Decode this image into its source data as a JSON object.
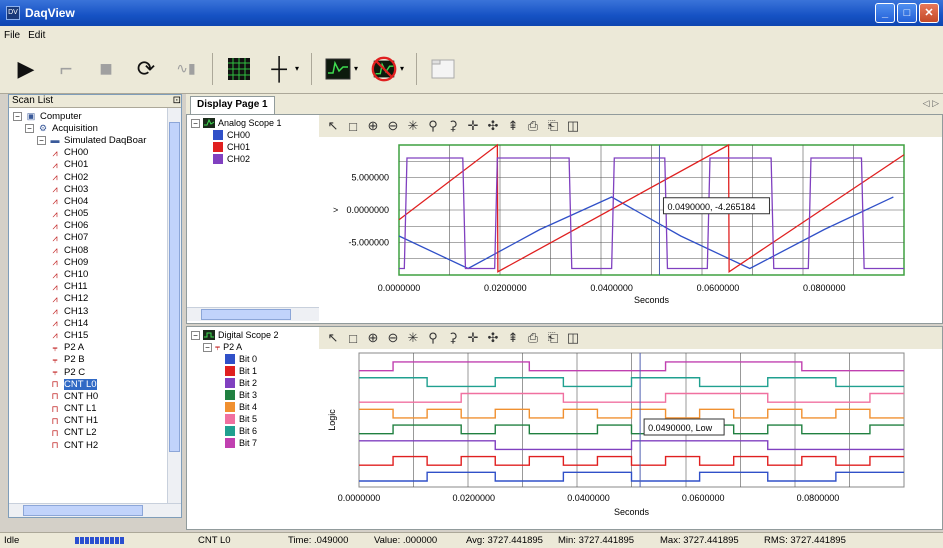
{
  "window": {
    "title": "DaqView",
    "icon_text": "DV"
  },
  "menu": {
    "items": [
      "File",
      "Edit"
    ]
  },
  "toolbar": {
    "icons": [
      "play-icon",
      "trigger-icon",
      "stop-icon",
      "cycle-icon",
      "waveform-icon",
      "grid-icon",
      "crosshair-icon",
      "scope-icon",
      "no-scope-icon",
      "blank-page-icon"
    ]
  },
  "scanlist": {
    "header": "Scan List",
    "tree": [
      {
        "label": "Computer",
        "level": 0,
        "expand": "⊟",
        "icon": "computer-icon"
      },
      {
        "label": "Acquisition",
        "level": 1,
        "expand": "⊟",
        "icon": "acquisition-icon"
      },
      {
        "label": "Simulated DaqBoar",
        "level": 2,
        "expand": "⊟",
        "icon": "board-icon"
      },
      {
        "label": "CH00",
        "level": 3,
        "icon": "analog-channel-icon"
      },
      {
        "label": "CH01",
        "level": 3,
        "icon": "analog-channel-icon"
      },
      {
        "label": "CH02",
        "level": 3,
        "icon": "analog-channel-icon"
      },
      {
        "label": "CH03",
        "level": 3,
        "icon": "analog-channel-icon"
      },
      {
        "label": "CH04",
        "level": 3,
        "icon": "analog-channel-icon"
      },
      {
        "label": "CH05",
        "level": 3,
        "icon": "analog-channel-icon"
      },
      {
        "label": "CH06",
        "level": 3,
        "icon": "analog-channel-icon"
      },
      {
        "label": "CH07",
        "level": 3,
        "icon": "analog-channel-icon"
      },
      {
        "label": "CH08",
        "level": 3,
        "icon": "analog-channel-icon"
      },
      {
        "label": "CH09",
        "level": 3,
        "icon": "analog-channel-icon"
      },
      {
        "label": "CH10",
        "level": 3,
        "icon": "analog-channel-icon"
      },
      {
        "label": "CH11",
        "level": 3,
        "icon": "analog-channel-icon"
      },
      {
        "label": "CH12",
        "level": 3,
        "icon": "analog-channel-icon"
      },
      {
        "label": "CH13",
        "level": 3,
        "icon": "analog-channel-icon"
      },
      {
        "label": "CH14",
        "level": 3,
        "icon": "analog-channel-icon"
      },
      {
        "label": "CH15",
        "level": 3,
        "icon": "analog-channel-icon"
      },
      {
        "label": "P2 A",
        "level": 3,
        "icon": "digital-port-icon"
      },
      {
        "label": "P2 B",
        "level": 3,
        "icon": "digital-port-icon"
      },
      {
        "label": "P2 C",
        "level": 3,
        "icon": "digital-port-icon"
      },
      {
        "label": "CNT L0",
        "level": 3,
        "icon": "counter-icon",
        "selected": true
      },
      {
        "label": "CNT H0",
        "level": 3,
        "icon": "counter-icon"
      },
      {
        "label": "CNT L1",
        "level": 3,
        "icon": "counter-icon"
      },
      {
        "label": "CNT H1",
        "level": 3,
        "icon": "counter-icon"
      },
      {
        "label": "CNT L2",
        "level": 3,
        "icon": "counter-icon"
      },
      {
        "label": "CNT H2",
        "level": 3,
        "icon": "counter-icon"
      }
    ]
  },
  "display": {
    "tab": "Display Page 1"
  },
  "analog_scope": {
    "name": "Analog Scope 1",
    "channels": [
      {
        "name": "CH00",
        "color": "#3050c8"
      },
      {
        "name": "CH01",
        "color": "#e02020"
      },
      {
        "name": "CH02",
        "color": "#8040c0"
      }
    ],
    "cursor_readout": "0.0490000, -4.265184",
    "cursor_marker": ">",
    "y_ticks": [
      "5.000000",
      "0.0000000",
      "-5.000000"
    ],
    "x_ticks": [
      "0.0000000",
      "0.0200000",
      "0.0400000",
      "0.0600000",
      "0.0800000"
    ],
    "xlabel": "Seconds"
  },
  "digital_scope": {
    "name": "Digital Scope 2",
    "port": "P2  A",
    "bits": [
      {
        "name": "Bit 0",
        "color": "#3050c8"
      },
      {
        "name": "Bit 1",
        "color": "#e02020"
      },
      {
        "name": "Bit 2",
        "color": "#8040c0"
      },
      {
        "name": "Bit 3",
        "color": "#208040"
      },
      {
        "name": "Bit 4",
        "color": "#f09030"
      },
      {
        "name": "Bit 5",
        "color": "#f070a0"
      },
      {
        "name": "Bit 6",
        "color": "#20a090"
      },
      {
        "name": "Bit 7",
        "color": "#c040b0"
      }
    ],
    "cursor_readout": "0.0490000, Low",
    "ylabel": "Logic",
    "x_ticks": [
      "0.0000000",
      "0.0200000",
      "0.0400000",
      "0.0600000",
      "0.0800000"
    ],
    "xlabel": "Seconds"
  },
  "status": {
    "state": "Idle",
    "channel": "CNT L0",
    "time": "Time: .049000",
    "value": "Value: .000000",
    "avg": "Avg: 3727.441895",
    "min": "Min: 3727.441895",
    "max": "Max: 3727.441895",
    "rms": "RMS: 3727.441895"
  },
  "chart_data": [
    {
      "type": "line",
      "title": "Analog Scope 1",
      "xlabel": "Seconds",
      "ylabel": "",
      "xlim": [
        0,
        0.095
      ],
      "ylim": [
        -10,
        10
      ],
      "series": [
        {
          "name": "CH00",
          "x": [
            0,
            0.013,
            0.0265,
            0.04,
            0.053,
            0.066,
            0.08,
            0.093
          ],
          "y": [
            -4,
            -9,
            -3,
            2,
            -4,
            -9,
            -3,
            2
          ]
        },
        {
          "name": "CH01",
          "x": [
            0,
            0.0185,
            0.0186,
            0.062,
            0.0621,
            0.095
          ],
          "y": [
            -1.5,
            10,
            -9.5,
            10,
            -9.5,
            8.5
          ]
        },
        {
          "name": "CH02",
          "x": [
            0,
            0.001,
            0.0015,
            0.012,
            0.0125,
            0.018,
            0.0185,
            0.032,
            0.0325,
            0.04,
            0.0405,
            0.05,
            0.0505,
            0.058,
            0.0585,
            0.07,
            0.0705,
            0.077,
            0.0775,
            0.087,
            0.0875,
            0.095
          ],
          "y": [
            -9,
            -9,
            8,
            8,
            -9,
            -9,
            8,
            8,
            -9,
            -9,
            8,
            8,
            -9,
            -9,
            8,
            8,
            -9,
            -9,
            8,
            8,
            -9,
            -9
          ]
        }
      ]
    },
    {
      "type": "line",
      "title": "Digital Scope 2",
      "xlabel": "Seconds",
      "ylabel": "Logic",
      "xlim": [
        0,
        0.095
      ],
      "ylim": [
        0,
        8
      ],
      "series": [
        {
          "name": "Bit 0",
          "pattern": [
            0,
            0,
            1,
            1,
            0,
            0,
            1,
            1,
            0,
            0,
            1,
            1,
            0,
            0,
            1,
            1
          ]
        },
        {
          "name": "Bit 1",
          "pattern": [
            0,
            1,
            0,
            1,
            0,
            1,
            0,
            1,
            0,
            1,
            0,
            1,
            0,
            1,
            0,
            1
          ]
        },
        {
          "name": "Bit 2",
          "pattern": [
            1,
            1,
            1,
            1,
            0,
            0,
            0,
            0,
            1,
            1,
            1,
            1,
            0,
            0,
            0,
            0
          ]
        },
        {
          "name": "Bit 3",
          "pattern": [
            0,
            1,
            1,
            0,
            1,
            0,
            0,
            1,
            0,
            1,
            1,
            0,
            1,
            0,
            0,
            1
          ]
        },
        {
          "name": "Bit 4",
          "pattern": [
            1,
            0,
            1,
            0,
            1,
            0,
            1,
            0,
            1,
            0,
            1,
            0,
            1,
            0,
            1,
            0
          ]
        },
        {
          "name": "Bit 5",
          "pattern": [
            0,
            0,
            0,
            1,
            1,
            1,
            0,
            0,
            0,
            1,
            1,
            1,
            0,
            0,
            0,
            1
          ]
        },
        {
          "name": "Bit 6",
          "pattern": [
            1,
            1,
            0,
            0,
            1,
            1,
            0,
            0,
            1,
            1,
            0,
            0,
            1,
            1,
            0,
            0
          ]
        },
        {
          "name": "Bit 7",
          "pattern": [
            0,
            1,
            1,
            1,
            1,
            0,
            0,
            0,
            0,
            1,
            1,
            1,
            1,
            0,
            0,
            0
          ]
        }
      ]
    }
  ]
}
